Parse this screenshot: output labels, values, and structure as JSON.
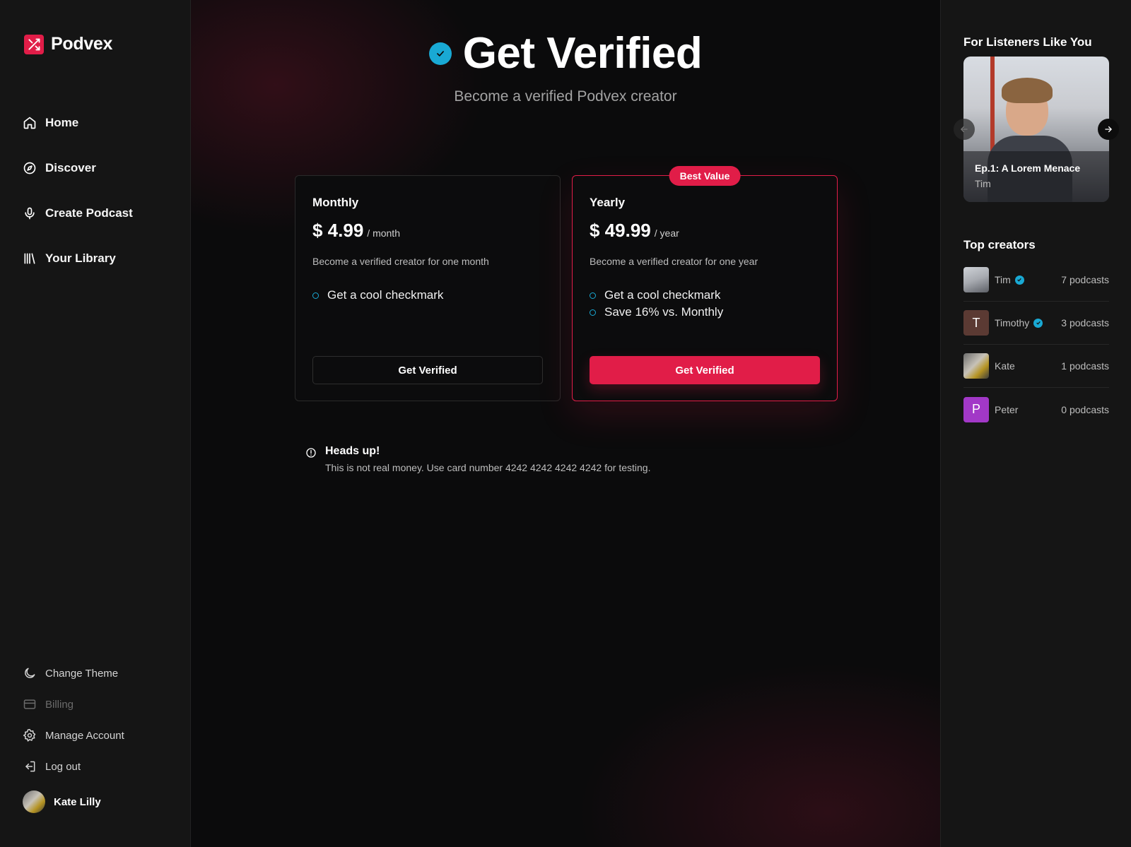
{
  "app": {
    "name": "Podvex"
  },
  "nav": {
    "items": [
      {
        "label": "Home",
        "icon": "home-icon"
      },
      {
        "label": "Discover",
        "icon": "compass-icon"
      },
      {
        "label": "Create Podcast",
        "icon": "microphone-icon"
      },
      {
        "label": "Your Library",
        "icon": "library-icon"
      }
    ]
  },
  "bottom_menu": {
    "items": [
      {
        "label": "Change Theme",
        "icon": "moon-icon"
      },
      {
        "label": "Billing",
        "icon": "credit-card-icon"
      },
      {
        "label": "Manage Account",
        "icon": "gear-icon"
      },
      {
        "label": "Log out",
        "icon": "logout-icon"
      }
    ]
  },
  "user": {
    "name": "Kate Lilly"
  },
  "hero": {
    "title": "Get Verified",
    "subtitle": "Become a verified Podvex creator"
  },
  "plans": [
    {
      "name": "Monthly",
      "price": "$ 4.99",
      "period": "/ month",
      "description": "Become a verified creator for one month",
      "features": [
        "Get a cool checkmark"
      ],
      "button": "Get Verified"
    },
    {
      "name": "Yearly",
      "badge": "Best Value",
      "price": "$ 49.99",
      "period": "/ year",
      "description": "Become a verified creator for one year",
      "features": [
        "Get a cool checkmark",
        "Save 16% vs. Monthly"
      ],
      "button": "Get Verified"
    }
  ],
  "alert": {
    "title": "Heads up!",
    "text": "This is not real money. Use card number 4242 4242 4242 4242 for testing."
  },
  "right_panel": {
    "listeners_title": "For Listeners Like You",
    "featured": {
      "title": "Ep.1: A Lorem Menace",
      "author": "Tim"
    },
    "creators_title": "Top creators",
    "creators": [
      {
        "name": "Tim",
        "verified": true,
        "count": "7 podcasts",
        "initial": ""
      },
      {
        "name": "Timothy",
        "verified": true,
        "count": "3 podcasts",
        "initial": "T"
      },
      {
        "name": "Kate",
        "verified": false,
        "count": "1 podcasts",
        "initial": ""
      },
      {
        "name": "Peter",
        "verified": false,
        "count": "0 podcasts",
        "initial": "P"
      }
    ]
  },
  "colors": {
    "accent": "#e11d48",
    "verified": "#19a9d4",
    "timothy_avatar": "#5b3a33",
    "peter_avatar": "#a238c7"
  }
}
